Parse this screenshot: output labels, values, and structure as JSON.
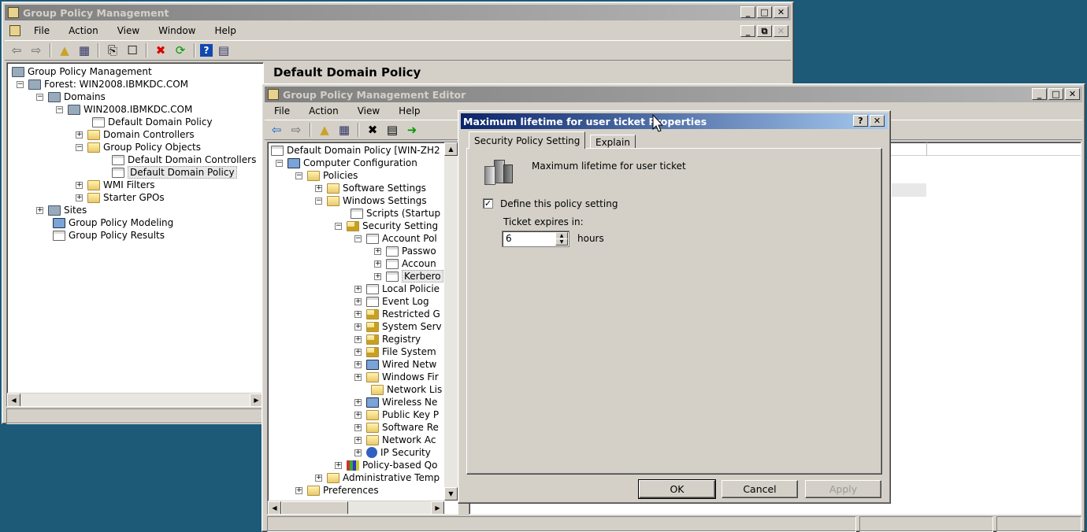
{
  "gpm": {
    "title": "Group Policy Management",
    "menu": [
      "File",
      "Action",
      "View",
      "Window",
      "Help"
    ],
    "header": "Default Domain Policy",
    "tree": [
      {
        "label": "Group Policy Management"
      },
      {
        "label": "Forest: WIN2008.IBMKDC.COM"
      },
      {
        "label": "Domains"
      },
      {
        "label": "WIN2008.IBMKDC.COM"
      },
      {
        "label": "Default Domain Policy"
      },
      {
        "label": "Domain Controllers"
      },
      {
        "label": "Group Policy Objects"
      },
      {
        "label": "Default Domain Controllers"
      },
      {
        "label": "Default Domain Policy"
      },
      {
        "label": "WMI Filters"
      },
      {
        "label": "Starter GPOs"
      },
      {
        "label": "Sites"
      },
      {
        "label": "Group Policy Modeling"
      },
      {
        "label": "Group Policy Results"
      }
    ]
  },
  "editor": {
    "title": "Group Policy Management Editor",
    "menu": [
      "File",
      "Action",
      "View",
      "Help"
    ],
    "tree": [
      {
        "label": "Default Domain Policy [WIN-ZH2"
      },
      {
        "label": "Computer Configuration"
      },
      {
        "label": "Policies"
      },
      {
        "label": "Software Settings"
      },
      {
        "label": "Windows Settings"
      },
      {
        "label": "Scripts (Startup"
      },
      {
        "label": "Security Setting"
      },
      {
        "label": "Account Pol"
      },
      {
        "label": "Passwo"
      },
      {
        "label": "Accoun"
      },
      {
        "label": "Kerbero"
      },
      {
        "label": "Local Policie"
      },
      {
        "label": "Event Log"
      },
      {
        "label": "Restricted G"
      },
      {
        "label": "System Serv"
      },
      {
        "label": "Registry"
      },
      {
        "label": "File System"
      },
      {
        "label": "Wired Netw"
      },
      {
        "label": "Windows Fir"
      },
      {
        "label": "Network Lis"
      },
      {
        "label": "Wireless Ne"
      },
      {
        "label": "Public Key P"
      },
      {
        "label": "Software Re"
      },
      {
        "label": "Network Ac"
      },
      {
        "label": "IP Security"
      },
      {
        "label": "Policy-based Qo"
      },
      {
        "label": "Administrative Temp"
      },
      {
        "label": "Preferences"
      }
    ]
  },
  "dialog": {
    "title": "Maximum lifetime for user ticket Properties",
    "tabs": [
      "Security Policy Setting",
      "Explain"
    ],
    "policy_name": "Maximum lifetime for user ticket",
    "define_label": "Define this policy setting",
    "define_checked": true,
    "expires_label": "Ticket expires in:",
    "expires_value": "6",
    "unit": "hours",
    "ok": "OK",
    "cancel": "Cancel",
    "apply": "Apply"
  }
}
